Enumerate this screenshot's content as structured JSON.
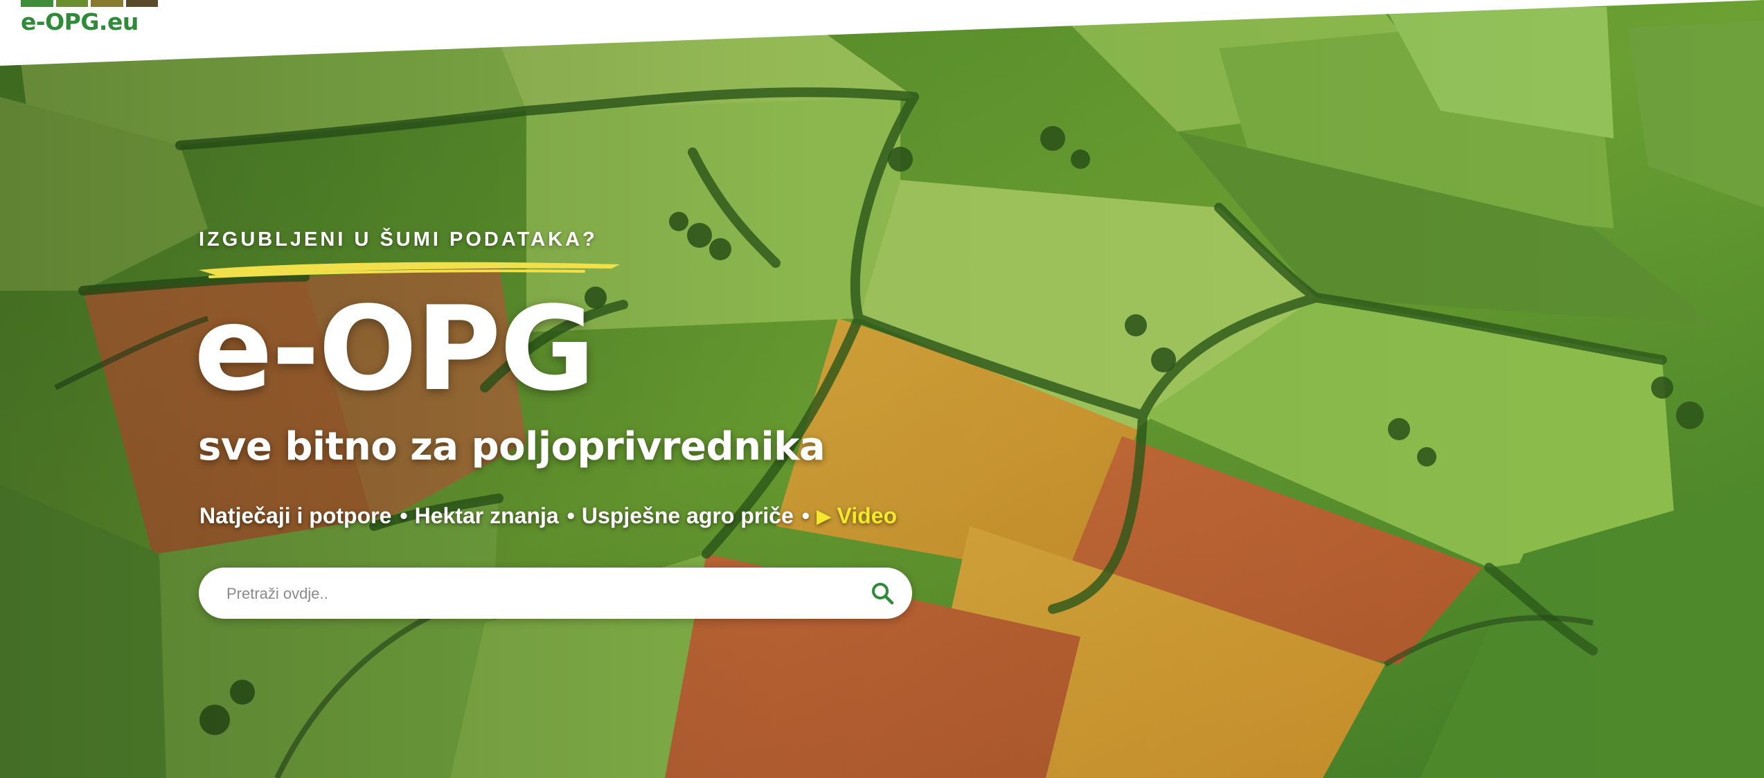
{
  "header": {
    "logo_text": "e-OPG.eu",
    "logo_bar_colors": [
      "#3f8c3b",
      "#6b8f2d",
      "#8a7a2f",
      "#5a4a2a"
    ]
  },
  "hero": {
    "kicker": "IZGUBLJENI U ŠUMI PODATAKA?",
    "title": "e-OPG",
    "tagline": "sve bitno za poljoprivrednika",
    "nav_links": [
      {
        "label": "Natječaji i potpore"
      },
      {
        "label": "Hektar znanja"
      },
      {
        "label": "Uspješne agro priče"
      },
      {
        "label": "Video"
      }
    ],
    "link_separator": "•",
    "video_play_symbol": "▶",
    "video_icon": "play-icon"
  },
  "search": {
    "placeholder": "Pretraži ovdje..",
    "value": "",
    "icon": "search-icon"
  },
  "colors": {
    "brand_green": "#2f8a39",
    "video_yellow": "#f3e92a",
    "underline_yellow": "#f1e04a"
  }
}
